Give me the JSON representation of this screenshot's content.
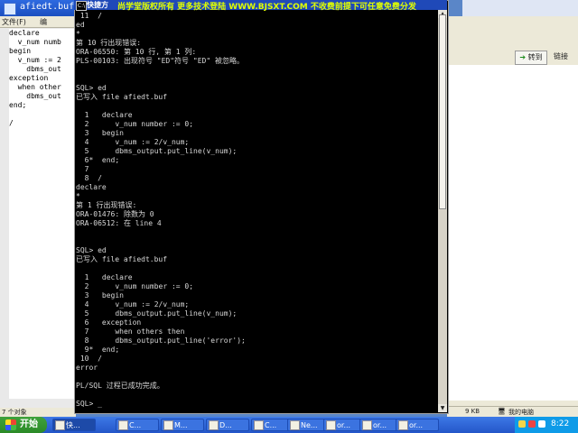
{
  "notepad": {
    "title": "afiedt.buf",
    "menu": [
      "文件(F)",
      "编"
    ],
    "text_lines": [
      "declare",
      "  v_num numb",
      "begin",
      "  v_num := 2",
      "    dbms_out",
      "exception",
      "  when other",
      "    dbms_out",
      "end;",
      "",
      "/"
    ],
    "status_objects": "7 个对象"
  },
  "cmd": {
    "title": "快捷方",
    "banner": "尚学堂版权所有  更多技术登陆  WWW.BJSXT.COM  不收费前提下可任意免费分发",
    "lines": [
      " 11  /",
      "ed",
      "*",
      "第 10 行出现错误:",
      "ORA-06550: 第 10 行, 第 1 列:",
      "PLS-00103: 出现符号 \"ED\"符号 \"ED\" 被忽略。",
      "",
      "",
      "SQL> ed",
      "已写入 file afiedt.buf",
      "",
      "  1   declare",
      "  2      v_num number := 0;",
      "  3   begin",
      "  4      v_num := 2/v_num;",
      "  5      dbms_output.put_line(v_num);",
      "  6*  end;",
      "  7",
      "  8  /",
      "declare",
      "*",
      "第 1 行出现错误:",
      "ORA-01476: 除数为 0",
      "ORA-06512: 在 line 4",
      "",
      "",
      "SQL> ed",
      "已写入 file afiedt.buf",
      "",
      "  1   declare",
      "  2      v_num number := 0;",
      "  3   begin",
      "  4      v_num := 2/v_num;",
      "  5      dbms_output.put_line(v_num);",
      "  6   exception",
      "  7      when others then",
      "  8      dbms_output.put_line('error');",
      "  9*  end;",
      " 10  /",
      "error",
      "",
      "PL/SQL 过程已成功完成。",
      "",
      "SQL> _"
    ]
  },
  "browser": {
    "goto_label": "转到",
    "links_label": "链接",
    "status_size": "9 KB",
    "status_zone": "我的电脑"
  },
  "taskbar": {
    "start_label": "开始",
    "items": [
      "快...",
      "C...",
      "M...",
      "D...",
      "C...",
      "Ne...",
      "or...",
      "or...",
      "or..."
    ],
    "clock": "8:22"
  },
  "colors": {
    "cmd_text": "#d8d8d8",
    "banner": "#e1ff00",
    "taskbar": "#2456c9",
    "start": "#2b8a27"
  }
}
